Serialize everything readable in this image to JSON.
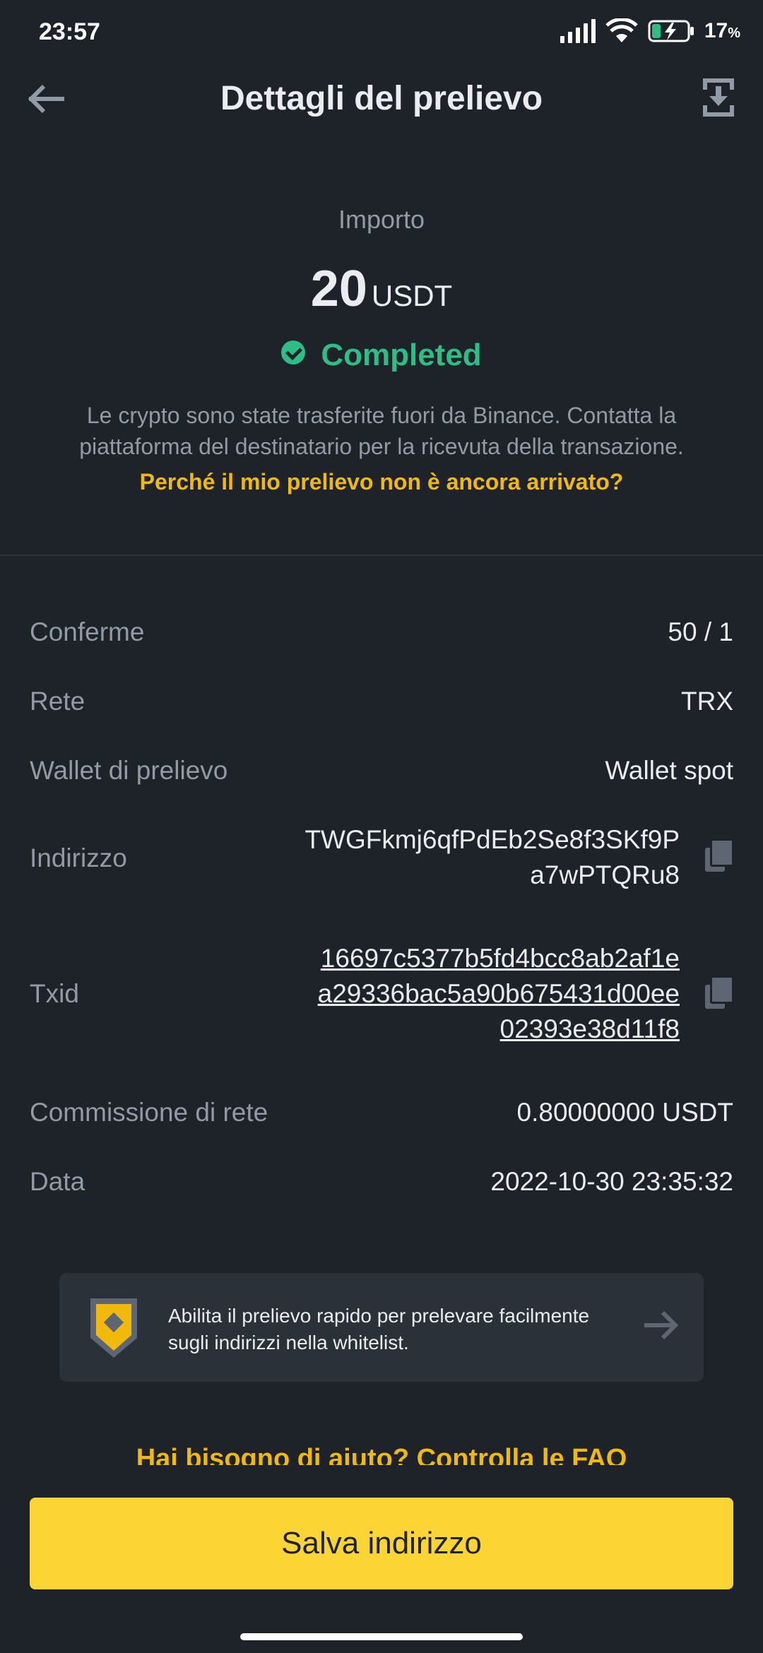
{
  "status_bar": {
    "time": "23:57",
    "battery": "17",
    "battery_unit": "%"
  },
  "header": {
    "title": "Dettagli del prelievo"
  },
  "amount": {
    "label": "Importo",
    "value": "20",
    "currency": "USDT"
  },
  "status": {
    "text": "Completed",
    "color": "#2ebd85"
  },
  "description": "Le crypto sono state trasferite fuori da Binance. Contatta la piattaforma del destinatario per la ricevuta della transazione.",
  "why_link": "Perché il mio prelievo non è ancora arrivato?",
  "details": {
    "confirmations": {
      "label": "Conferme",
      "value": "50 / 1"
    },
    "network": {
      "label": "Rete",
      "value": "TRX"
    },
    "wallet": {
      "label": "Wallet di prelievo",
      "value": "Wallet spot"
    },
    "address": {
      "label": "Indirizzo",
      "line1": "TWGFkmj6qfPdEb2Se8f3SKf9P",
      "line2": "a7wPTQRu8"
    },
    "txid": {
      "label": "Txid",
      "line1": "16697c5377b5fd4bcc8ab2af1e",
      "line2": "a29336bac5a90b675431d00ee",
      "line3": "02393e38d11f8"
    },
    "fee": {
      "label": "Commissione di rete",
      "value": "0.80000000 USDT"
    },
    "date": {
      "label": "Data",
      "value": "2022-10-30 23:35:32"
    }
  },
  "banner": {
    "text": "Abilita il prelievo rapido per prelevare facilmente sugli indirizzi nella whitelist.",
    "icon": "shield-icon"
  },
  "help_link": "Hai bisogno di aiuto? Controlla le FAQ",
  "save_button": "Salva indirizzo",
  "colors": {
    "background": "#1e2329",
    "accent": "#f0b90b",
    "button": "#fcd535",
    "muted": "#929aa5"
  }
}
